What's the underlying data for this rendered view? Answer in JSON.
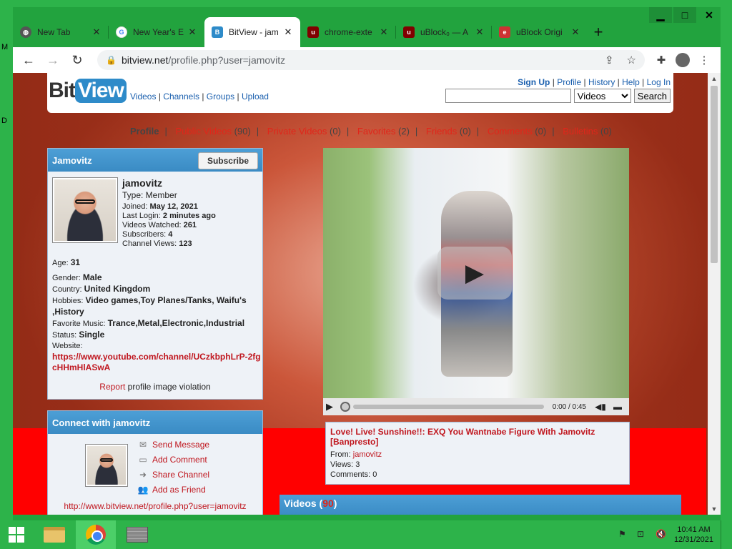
{
  "window_controls": {
    "minimize": "▁",
    "maximize": "□",
    "close": "✕"
  },
  "tabs": [
    {
      "title": "New Tab",
      "favicon": "globe-icon",
      "color": "#666"
    },
    {
      "title": "New Year's E",
      "favicon": "google-icon",
      "color": "#4285f4"
    },
    {
      "title": "BitView - jam",
      "favicon": "bitview-icon",
      "color": "#2e8bc9",
      "active": true
    },
    {
      "title": "chrome-exte",
      "favicon": "ublock-icon",
      "color": "#800000"
    },
    {
      "title": "uBlock₀ — A",
      "favicon": "ublock-icon",
      "color": "#800000"
    },
    {
      "title": "uBlock Origi",
      "favicon": "extension-icon",
      "color": "#c33"
    }
  ],
  "new_tab": "+",
  "address": {
    "host": "bitview.net",
    "path": "/profile.php?user=jamovitz"
  },
  "site": {
    "logo_bit": "Bit",
    "logo_view": "View",
    "nav": [
      "Videos",
      "Channels",
      "Groups",
      "Upload"
    ],
    "toplinks": [
      "Sign Up",
      "Profile",
      "History",
      "Help",
      "Log In"
    ],
    "search_placeholder": "",
    "search_select": "Videos",
    "search_button": "Search"
  },
  "profile_tabs": [
    {
      "label": "Profile",
      "count": ""
    },
    {
      "label": "Public Videos",
      "count": "(90)"
    },
    {
      "label": "Private Videos",
      "count": "(0)"
    },
    {
      "label": "Favorites",
      "count": "(2)"
    },
    {
      "label": "Friends",
      "count": "(0)"
    },
    {
      "label": "Comments",
      "count": "(0)"
    },
    {
      "label": "Bulletins",
      "count": "(0)"
    }
  ],
  "profile": {
    "header": "Jamovitz",
    "subscribe": "Subscribe",
    "username": "jamovitz",
    "type": "Type: Member",
    "joined_label": "Joined:",
    "joined": "May 12, 2021",
    "lastlogin_label": "Last Login:",
    "lastlogin": "2 minutes ago",
    "watched_label": "Videos Watched:",
    "watched": "261",
    "subs_label": "Subscribers:",
    "subs": "4",
    "views_label": "Channel Views:",
    "views": "123",
    "age_label": "Age:",
    "age": "31",
    "gender_label": "Gender:",
    "gender": "Male",
    "country_label": "Country:",
    "country": "United Kingdom",
    "hobbies_label": "Hobbies:",
    "hobbies": "Video games,Toy Planes/Tanks, Waifu's ,History",
    "music_label": "Favorite Music:",
    "music": "Trance,Metal,Electronic,Industrial",
    "status_label": "Status:",
    "status": "Single",
    "website_label": "Website:",
    "website": "https://www.youtube.com/channel/UCzkbphLrP-2fgcHHmHlASwA",
    "report_link": "Report",
    "report_text": "profile image violation"
  },
  "connect": {
    "header": "Connect with jamovitz",
    "actions": [
      {
        "label": "Send Message",
        "icon": "envelope-icon"
      },
      {
        "label": "Add Comment",
        "icon": "comment-icon"
      },
      {
        "label": "Share Channel",
        "icon": "share-arrow-icon"
      },
      {
        "label": "Add as Friend",
        "icon": "add-friend-icon"
      }
    ],
    "url": "http://www.bitview.net/profile.php?user=jamovitz"
  },
  "player": {
    "time": "0:00 / 0:45"
  },
  "featured": {
    "title": "Love! Live! Sunshine!!: EXQ You Wantnabe Figure With Jamovitz [Banpresto]",
    "from_label": "From:",
    "from": "jamovitz",
    "views": "Views: 3",
    "comments": "Comments: 0"
  },
  "videos_box": {
    "label": "Videos",
    "count": "90"
  },
  "taskbar": {
    "time": "10:41 AM",
    "date": "12/31/2021"
  },
  "edge_glyphs": [
    "M",
    "D"
  ]
}
